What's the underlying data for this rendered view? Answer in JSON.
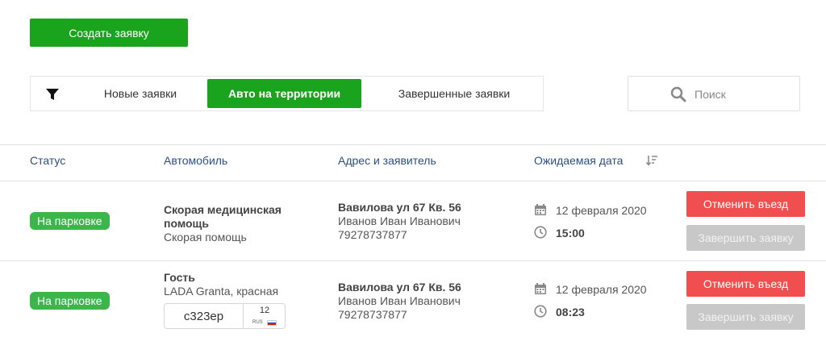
{
  "create_button": "Создать заявку",
  "filters": {
    "tabs": [
      "Новые заявки",
      "Авто на территории",
      "Завершенные заявки"
    ],
    "active_tab": "Авто на территории"
  },
  "search": {
    "placeholder": "Поиск",
    "value": ""
  },
  "table": {
    "headers": {
      "status": "Статус",
      "car": "Автомобиль",
      "address": "Адрес и заявитель",
      "date": "Ожидаемая дата"
    },
    "rows": [
      {
        "status": "На парковке",
        "car_title": [
          "Скорая медицинская",
          "помощь"
        ],
        "car_subtitle": "Скорая помощь",
        "address": "Вавилова ул 67 Кв. 56",
        "applicant": "Иванов Иван Иванович",
        "phone": "79278737877",
        "date": "12 февраля 2020",
        "time": "15:00",
        "cancel_label": "Отменить въезд",
        "finish_label": "Завершить заявку"
      },
      {
        "status": "На парковке",
        "car_title": [
          "Гость"
        ],
        "car_subtitle": "LADA Granta, красная",
        "plate": {
          "number": "с323ер",
          "region": "12",
          "country": "RUS"
        },
        "address": "Вавилова ул 67 Кв. 56",
        "applicant": "Иванов Иван Иванович",
        "phone": "79278737877",
        "date": "12 февраля 2020",
        "time": "08:23",
        "cancel_label": "Отменить въезд",
        "finish_label": "Завершить заявку"
      }
    ]
  },
  "colors": {
    "primary_green": "#1aa31c",
    "badge_green": "#3cb54a",
    "header_blue": "#2a4f86",
    "cancel_red": "#f04e4f",
    "disabled_gray": "#c8c8c8"
  },
  "icons": {
    "filter": "filter-icon",
    "search": "search-icon",
    "sort": "sort-icon",
    "calendar": "calendar-icon",
    "clock": "clock-icon"
  }
}
